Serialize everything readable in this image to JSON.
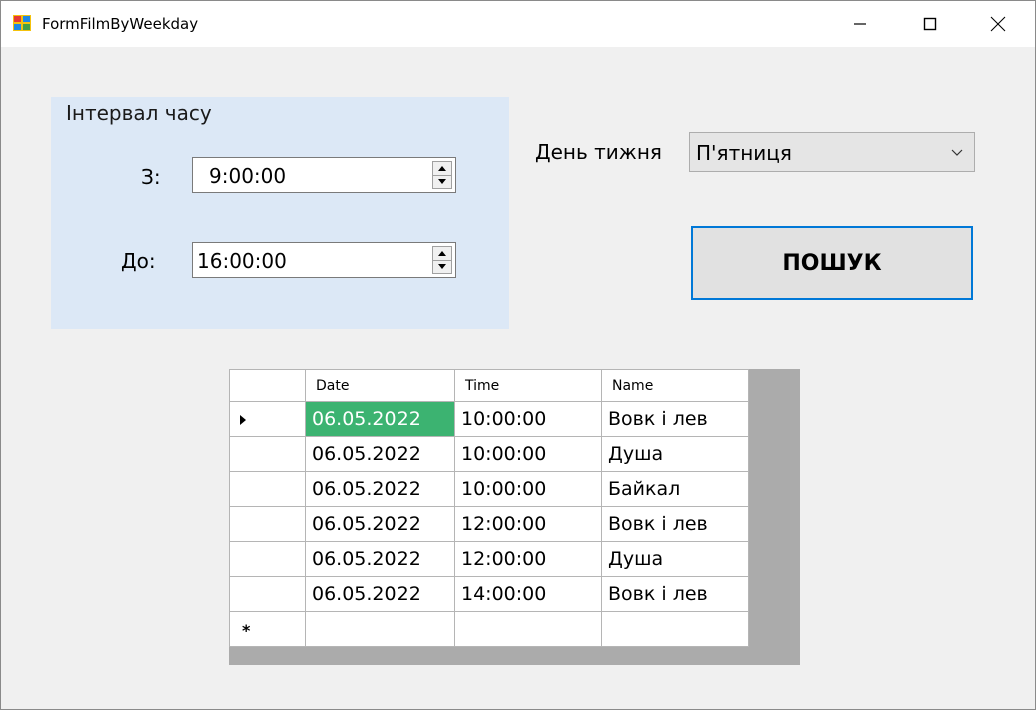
{
  "window": {
    "title": "FormFilmByWeekday",
    "minimize_glyph": "—",
    "maximize_glyph": "☐",
    "close_glyph": "✕"
  },
  "time_group": {
    "title": "Інтервал часу",
    "from_label": "З:",
    "from_value": "9:00:00",
    "to_label": "До:",
    "to_value": "16:00:00"
  },
  "weekday": {
    "label": "День тижня",
    "selected": "П'ятниця"
  },
  "search_button": {
    "label": "ПОШУК"
  },
  "grid": {
    "columns": [
      "Date",
      "Time",
      "Name"
    ],
    "rows": [
      {
        "date": "06.05.2022",
        "time": "10:00:00",
        "name": "Вовк і лев"
      },
      {
        "date": "06.05.2022",
        "time": "10:00:00",
        "name": "Душа"
      },
      {
        "date": "06.05.2022",
        "time": "10:00:00",
        "name": "Байкал"
      },
      {
        "date": "06.05.2022",
        "time": "12:00:00",
        "name": "Вовк і лев"
      },
      {
        "date": "06.05.2022",
        "time": "12:00:00",
        "name": "Душа"
      },
      {
        "date": "06.05.2022",
        "time": "14:00:00",
        "name": "Вовк і лев"
      }
    ],
    "new_row_marker": "*",
    "selected_color": "#3cb371"
  },
  "colors": {
    "group_background": "#dce8f6",
    "button_border": "#0078d7",
    "grid_background": "#ababab"
  },
  "icons": [
    "app-icon",
    "minimize-icon",
    "maximize-icon",
    "close-icon",
    "spin-up-icon",
    "spin-down-icon",
    "dropdown-arrow-icon",
    "row-pointer-icon"
  ]
}
